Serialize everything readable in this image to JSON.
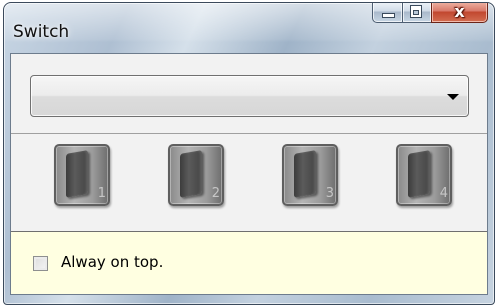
{
  "window": {
    "title": "Switch"
  },
  "caption_buttons": {
    "minimize": "minimize",
    "maximize": "maximize",
    "close_glyph": "x"
  },
  "combo": {
    "selected_value": ""
  },
  "switches": [
    {
      "number": "1",
      "icon": "rocker-switch-icon"
    },
    {
      "number": "2",
      "icon": "rocker-switch-icon"
    },
    {
      "number": "3",
      "icon": "rocker-switch-icon"
    },
    {
      "number": "4",
      "icon": "rocker-switch-icon"
    }
  ],
  "options": {
    "always_on_top_label": "Alway on top.",
    "always_on_top_checked": false
  },
  "colors": {
    "options_bar": "#ffffe1",
    "close_button": "#c1472f"
  }
}
